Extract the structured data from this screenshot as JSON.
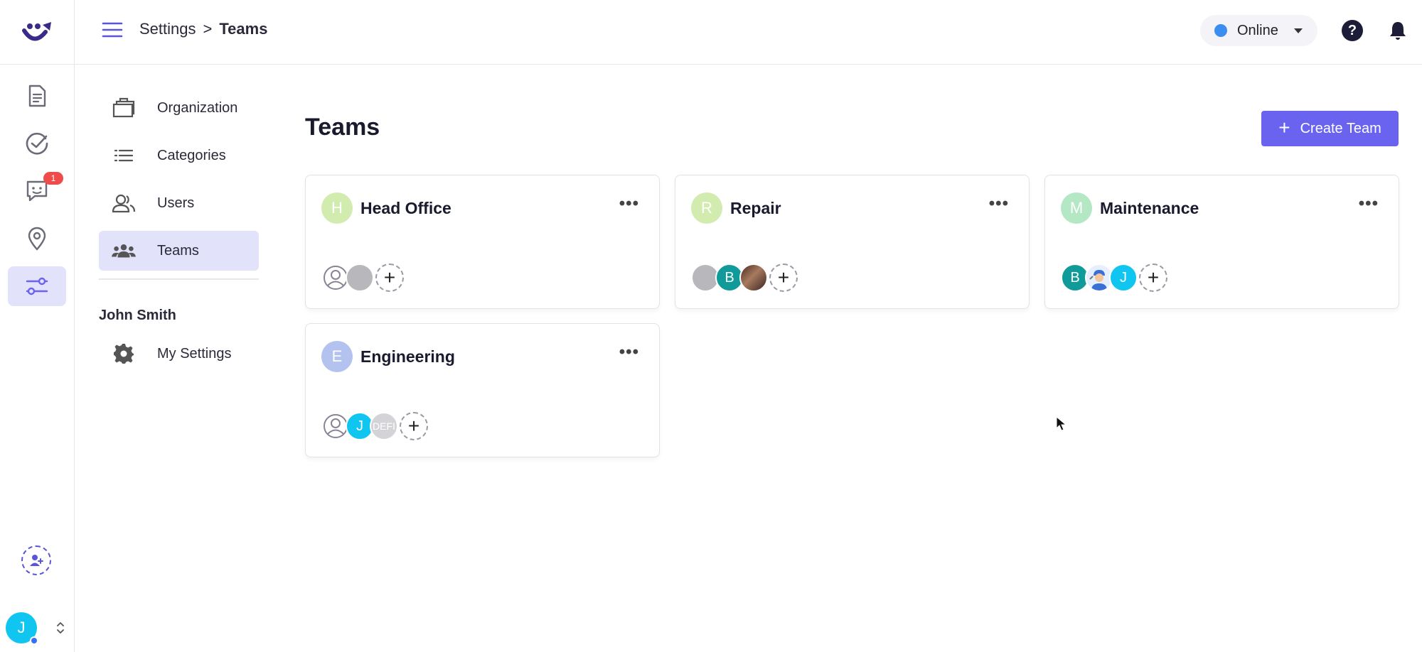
{
  "header": {
    "breadcrumb_root": "Settings",
    "breadcrumb_sep": ">",
    "breadcrumb_current": "Teams",
    "status_label": "Online",
    "status_color": "#3b8def",
    "help_glyph": "?"
  },
  "rail": {
    "chat_badge": "1",
    "user_initial": "J",
    "accent": "#6963f0"
  },
  "settings_nav": {
    "items": [
      {
        "label": "Organization",
        "icon": "briefcase-icon"
      },
      {
        "label": "Categories",
        "icon": "list-icon"
      },
      {
        "label": "Users",
        "icon": "users-icon"
      },
      {
        "label": "Teams",
        "icon": "team-icon"
      }
    ],
    "user_section_title": "John Smith",
    "my_settings_label": "My Settings"
  },
  "main": {
    "title": "Teams",
    "create_button_label": "Create Team",
    "teams": [
      {
        "initial": "H",
        "name": "Head Office",
        "avatar_color": "#d2ecb0",
        "members": []
      },
      {
        "initial": "R",
        "name": "Repair",
        "avatar_color": "#d2ecb0",
        "members": [
          "B"
        ]
      },
      {
        "initial": "M",
        "name": "Maintenance",
        "avatar_color": "#b4e8c4",
        "members": [
          "B",
          "J"
        ]
      },
      {
        "initial": "E",
        "name": "Engineering",
        "avatar_color": "#b3c2ee",
        "members": [
          "J",
          "DEFI"
        ]
      }
    ],
    "more_glyph": "•••",
    "add_member_glyph": "+"
  }
}
